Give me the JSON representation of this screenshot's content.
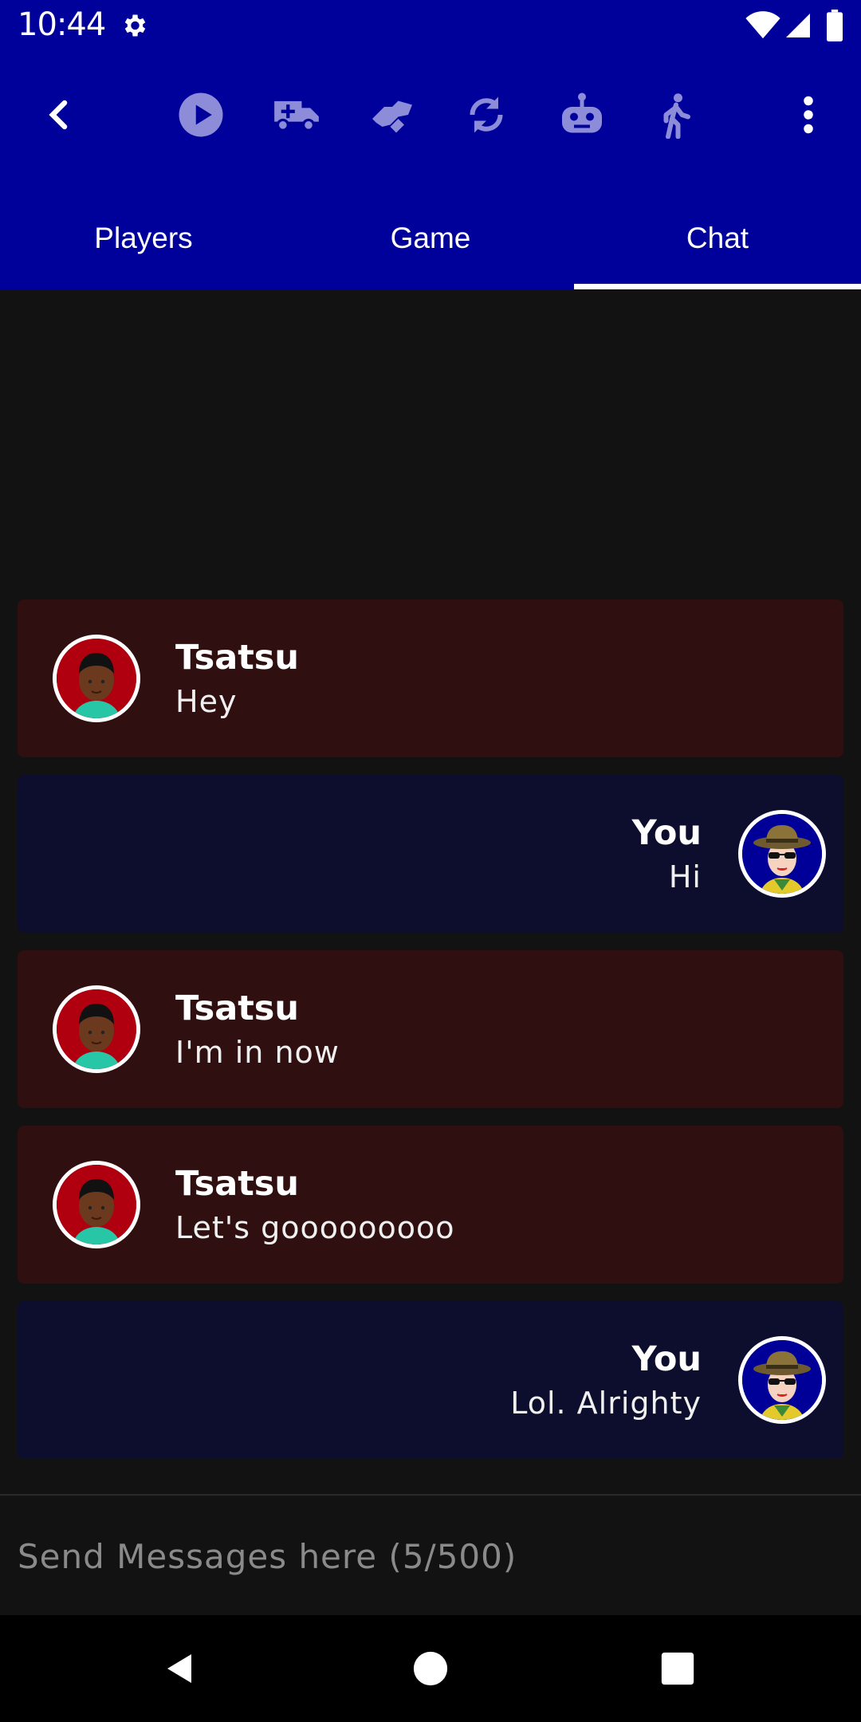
{
  "status_bar": {
    "time": "10:44"
  },
  "toolbar": {
    "icons": [
      "back-arrow-icon",
      "play-icon",
      "ambulance-icon",
      "handshake-icon",
      "sync-icon",
      "robot-icon",
      "walk-icon",
      "more-vert-icon"
    ]
  },
  "tabs": [
    {
      "label": "Players"
    },
    {
      "label": "Game"
    },
    {
      "label": "Chat"
    }
  ],
  "active_tab": "Chat",
  "messages": [
    {
      "sender": "Tsatsu",
      "text": "Hey",
      "from_me": false
    },
    {
      "sender": "You",
      "text": "Hi",
      "from_me": true
    },
    {
      "sender": "Tsatsu",
      "text": "I'm in now",
      "from_me": false
    },
    {
      "sender": "Tsatsu",
      "text": "Let's gooooooooo",
      "from_me": false
    },
    {
      "sender": "You",
      "text": "Lol. Alrighty",
      "from_me": true
    }
  ],
  "composer": {
    "placeholder": "Send Messages here (5/500)"
  },
  "colors": {
    "appbar": "#00009a",
    "background": "#121212",
    "other_message_bg": "#2f0f10",
    "my_message_bg": "#0d0d2e"
  }
}
